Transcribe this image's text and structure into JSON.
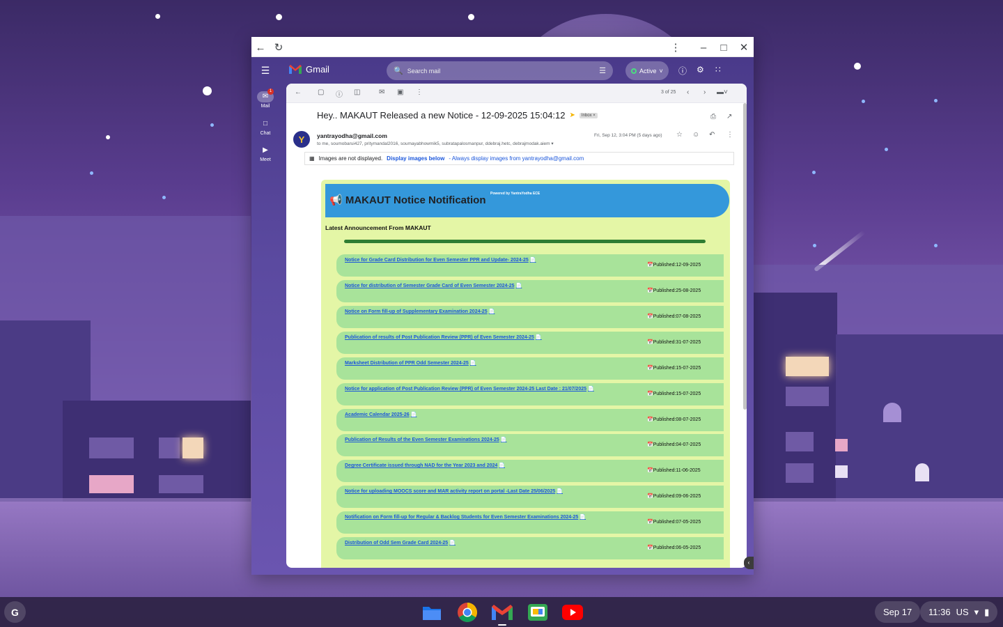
{
  "window": {
    "back_icon": "back-icon",
    "reload_icon": "reload-icon"
  },
  "gmail": {
    "brand": "Gmail",
    "search_placeholder": "Search mail",
    "status": "Active",
    "rail": [
      {
        "label": "Mail",
        "badge": "1"
      },
      {
        "label": "Chat"
      },
      {
        "label": "Meet"
      }
    ]
  },
  "toolbar": {
    "pager": "3 of 25"
  },
  "email": {
    "subject": "Hey.. MAKAUT Released a new Notice - 12-09-2025 15:04:12",
    "label": "Inbox",
    "from": "yantrayodha@gmail.com",
    "to": "to me, soumobarui427, pritymandal2016, soumayabhowmik5, subratapalosmanpur, ddebraj.hetc, debrajmodak.aiem",
    "date": "Fri, Sep 12, 3:04 PM (5 days ago)",
    "images_notice": "Images are not displayed.",
    "display_images": "Display images below",
    "always_display": "- Always display images from yantrayodha@gmail.com"
  },
  "notice": {
    "title": "📢 MAKAUT Notice Notification",
    "powered": "Powered by YantraYodha ECE",
    "latest": "Latest Announcement From MAKAUT",
    "items": [
      {
        "title": "Notice for Grade Card Distribution for Even Semester PPR and Update- 2024-25",
        "published": "📅Published:12-09-2025"
      },
      {
        "title": "Notice for distribution of Semester Grade Card of Even Semester 2024-25",
        "published": "📅Published:25-08-2025"
      },
      {
        "title": "Notice on Form fill-up of Supplementary Examination 2024-25",
        "published": "📅Published:07-08-2025"
      },
      {
        "title": "Publication of results of Post Publication Review (PPR) of Even Semester 2024-25",
        "published": "📅Published:31-07-2025"
      },
      {
        "title": "Marksheet Distribution of PPR Odd Semester 2024-25",
        "published": "📅Published:15-07-2025"
      },
      {
        "title": "Notice for application of Post Publication Review (PPR) of Even Semester 2024-25 Last Date : 21/07/2025",
        "published": "📅Published:15-07-2025"
      },
      {
        "title": "Academic Calendar 2025-26",
        "published": "📅Published:08-07-2025"
      },
      {
        "title": "Publication of Results of the Even Semester Examinations 2024-25",
        "published": "📅Published:04-07-2025"
      },
      {
        "title": "Degree Certificate issued through NAD for the Year 2023 and 2024",
        "published": "📅Published:11-06-2025"
      },
      {
        "title": "Notice for uploading MOOCS score and MAR activity report on portal -Last Date 25/06/2025",
        "published": "📅Published:09-06-2025"
      },
      {
        "title": "Notification on Form fill-up for Regular & Backlog Students for Even Semester Examinations 2024-25",
        "published": "📅Published:07-05-2025"
      },
      {
        "title": "Distribution of Odd Sem Grade Card 2024-25",
        "published": "📅Published:06-05-2025"
      }
    ]
  },
  "shelf": {
    "launcher": "G",
    "date": "Sep 17",
    "time": "11:36",
    "ime": "US"
  }
}
